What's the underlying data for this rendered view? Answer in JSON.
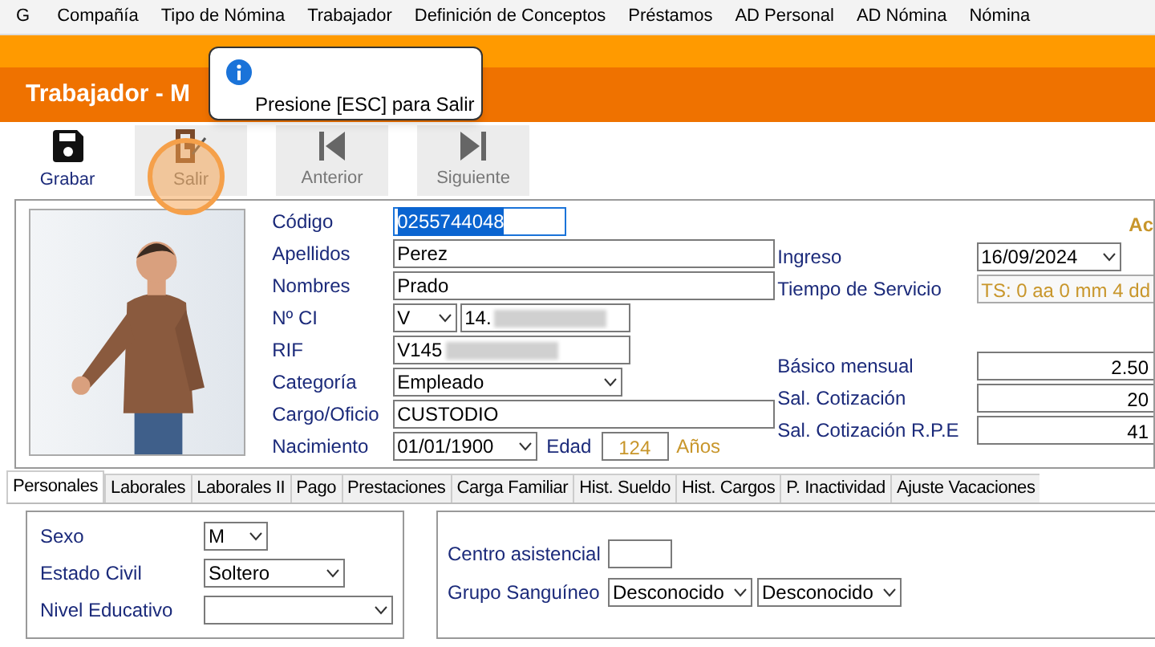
{
  "menu": [
    "G",
    "Compañía",
    "Tipo de Nómina",
    "Trabajador",
    "Definición de Conceptos",
    "Préstamos",
    "AD Personal",
    "AD Nómina",
    "Nómina"
  ],
  "window": {
    "title": "Trabajador - M"
  },
  "tooltip": {
    "text": "Presione [ESC] para Salir"
  },
  "toolbar": [
    {
      "label": "Grabar",
      "disabled": false,
      "click_indicator": false
    },
    {
      "label": "Salir",
      "disabled": true,
      "click_indicator": true
    },
    {
      "label": "Anterior",
      "disabled": true,
      "click_indicator": false
    },
    {
      "label": "Siguiente",
      "disabled": true,
      "click_indicator": false
    }
  ],
  "left_fields": [
    {
      "label": "Código",
      "kind": "text",
      "value": "0255744048",
      "focused": true
    },
    {
      "label": "Apellidos",
      "kind": "text",
      "value": "Perez",
      "focused": false
    },
    {
      "label": "Nombres",
      "kind": "text",
      "value": "Prado",
      "focused": false
    },
    {
      "label": "Nº CI",
      "kind": "ci",
      "prefix": "V",
      "value": "14.",
      "redacted": true
    },
    {
      "label": "RIF",
      "kind": "text",
      "value": "V145",
      "focused": false,
      "redacted": true
    },
    {
      "label": "Categoría",
      "kind": "select",
      "value": "Empleado"
    },
    {
      "label": "Cargo/Oficio",
      "kind": "text",
      "value": "CUSTODIO",
      "focused": false
    },
    {
      "label": "Nacimiento",
      "kind": "date",
      "value": "01/01/1900",
      "age_label": "Edad",
      "age": "124",
      "age_unit": "Años"
    }
  ],
  "status": "Ac",
  "right_fields": [
    {
      "label": "Ingreso",
      "kind": "date",
      "value": "16/09/2024"
    },
    {
      "label": "Tiempo de Servicio",
      "kind": "readonly",
      "value": "TS: 0 aa 0 mm 4 dd"
    },
    {
      "kind": "spacer"
    },
    {
      "label": "Básico mensual",
      "kind": "amount",
      "value": "2.50"
    },
    {
      "label": "Sal. Cotización",
      "kind": "amount",
      "value": "20"
    },
    {
      "label": "Sal. Cotización R.P.E",
      "kind": "amount",
      "value": "41"
    }
  ],
  "tabs": [
    {
      "label": "Personales",
      "selected": true
    },
    {
      "label": "Laborales",
      "selected": false
    },
    {
      "label": "Laborales II",
      "selected": false
    },
    {
      "label": "Pago",
      "selected": false
    },
    {
      "label": "Prestaciones",
      "selected": false
    },
    {
      "label": "Carga Familiar",
      "selected": false
    },
    {
      "label": "Hist. Sueldo",
      "selected": false
    },
    {
      "label": "Hist. Cargos",
      "selected": false
    },
    {
      "label": "P.  Inactividad",
      "selected": false
    },
    {
      "label": "Ajuste Vacaciones",
      "selected": false
    }
  ],
  "personal_left": [
    {
      "label": "Sexo",
      "kind": "select",
      "value": "M"
    },
    {
      "label": "Estado Civil",
      "kind": "select",
      "value": "Soltero"
    },
    {
      "label": "Nivel Educativo",
      "kind": "select"
    }
  ],
  "personal_right": [
    {
      "label": "Centro asistencial",
      "kind": "box"
    },
    {
      "label": "Grupo Sanguíneo",
      "kind": "double_select",
      "values": [
        "Desconocido",
        "Desconocido"
      ]
    }
  ]
}
